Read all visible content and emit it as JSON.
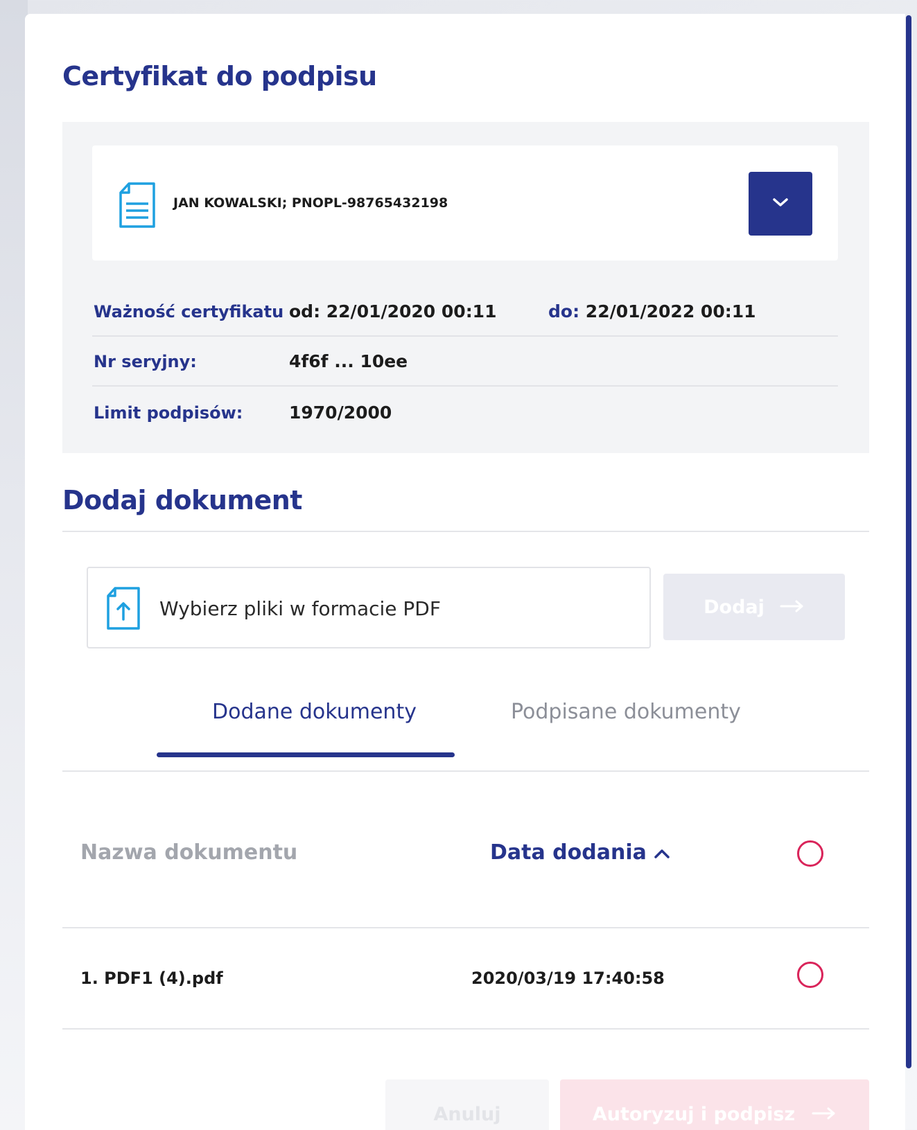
{
  "certificate": {
    "title": "Certyfikat do podpisu",
    "selected": "JAN KOWALSKI; PNOPL-98765432198",
    "validity_label": "Ważność certyfikatu",
    "valid_from": "od: 22/01/2020 00:11",
    "valid_to_prefix": "do:",
    "valid_to": "22/01/2022 00:11",
    "serial_label": "Nr seryjny:",
    "serial_value": "4f6f ... 10ee",
    "limit_label": "Limit podpisów:",
    "limit_value": "1970/2000"
  },
  "add_document": {
    "title": "Dodaj dokument",
    "file_placeholder": "Wybierz pliki w formacie PDF",
    "add_button": "Dodaj"
  },
  "tabs": [
    {
      "label": "Dodane dokumenty",
      "active": true
    },
    {
      "label": "Podpisane dokumenty",
      "active": false
    }
  ],
  "table": {
    "col_name": "Nazwa dokumentu",
    "col_date": "Data dodania",
    "rows": [
      {
        "name": "1. PDF1 (4).pdf",
        "date": "2020/03/19 17:40:58"
      }
    ]
  },
  "footer": {
    "cancel_button": "Anuluj",
    "sign_button": "Autoryzuj i podpisz"
  },
  "colors": {
    "primary": "#26348c",
    "accent_radio": "#d9245a",
    "icon_blue": "#1ea0e0"
  }
}
